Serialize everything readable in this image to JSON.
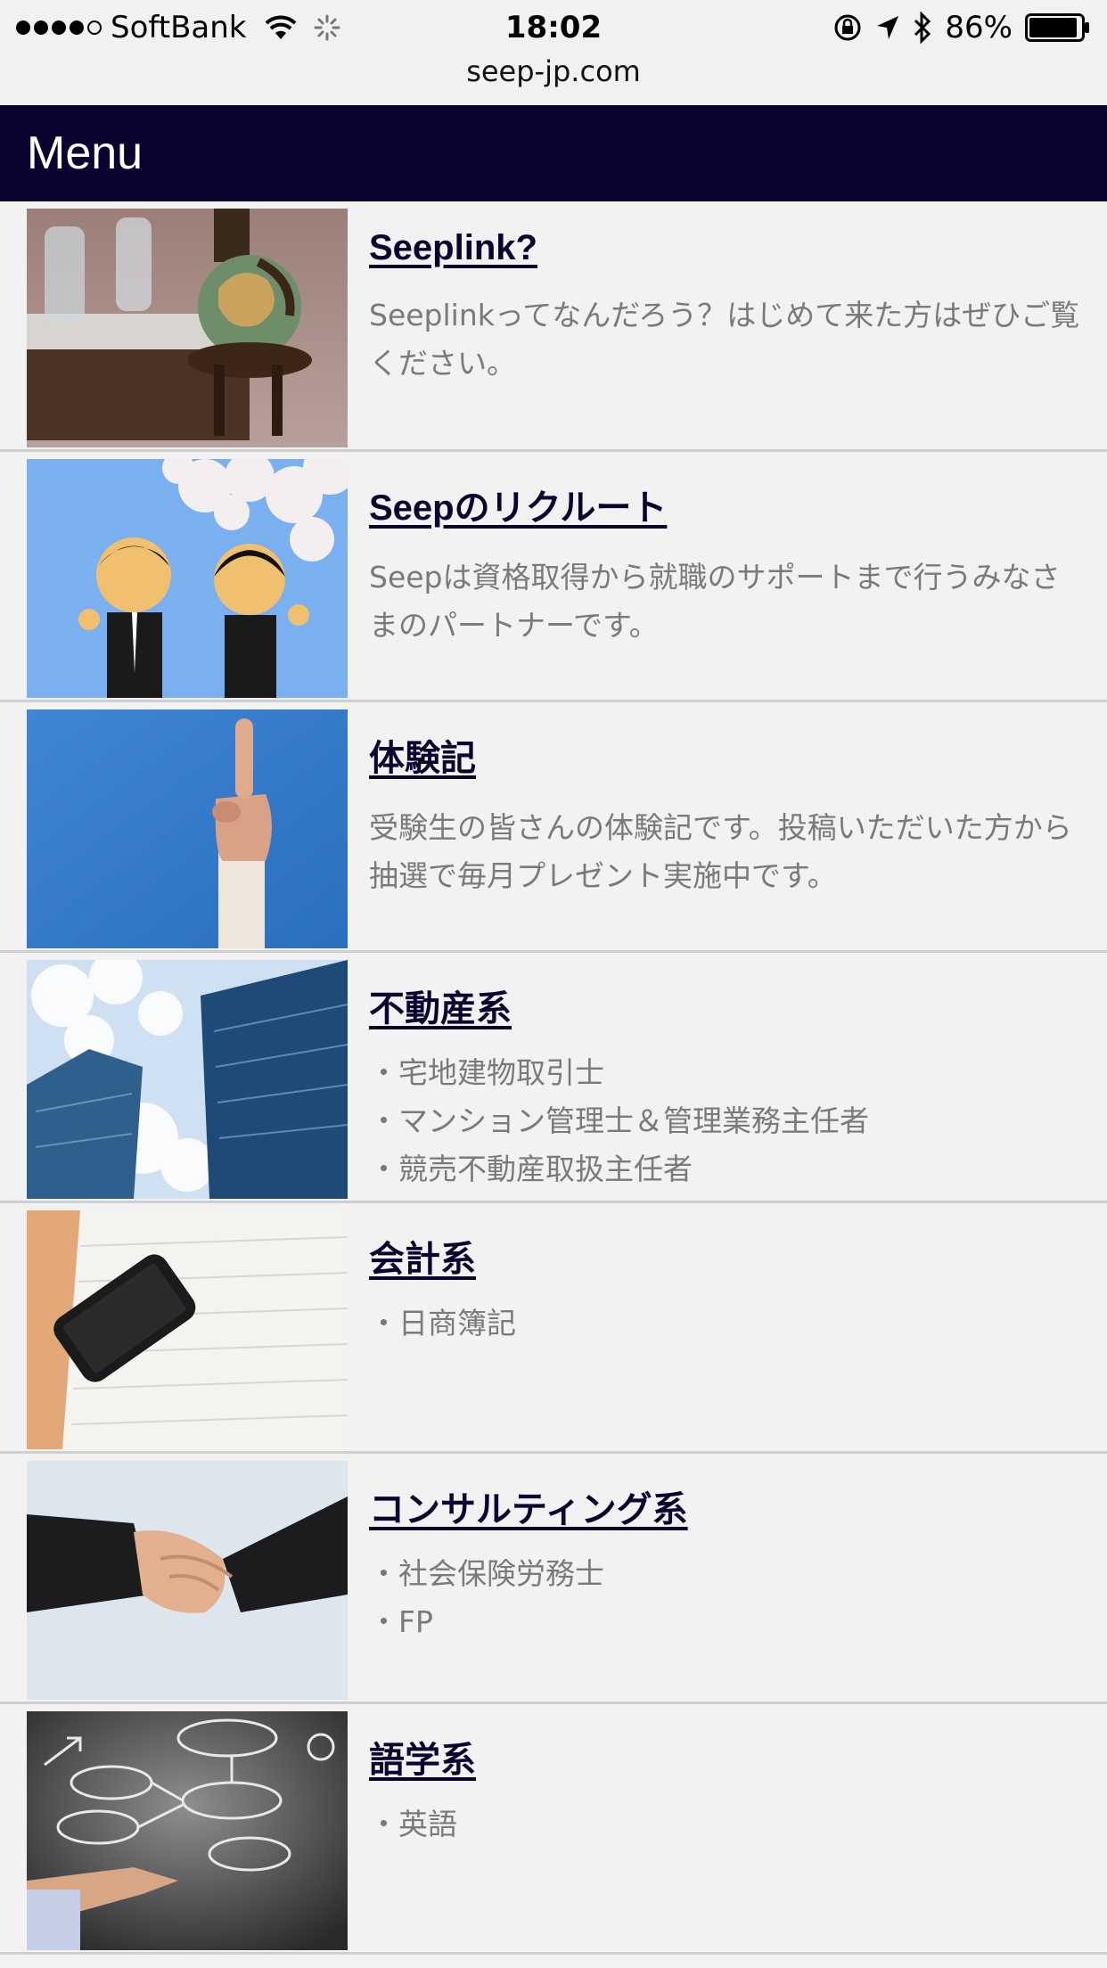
{
  "status_bar": {
    "carrier": "SoftBank",
    "time": "18:02",
    "battery": "86%",
    "signal_bars_filled": 4,
    "signal_bars_total": 5
  },
  "browser": {
    "url": "seep-jp.com"
  },
  "header": {
    "title": "Menu",
    "background_color": "#0b0230"
  },
  "menu": {
    "items": [
      {
        "title": "Seeplink?",
        "image_icon": "globe-and-book-photo",
        "description": "Seeplinkってなんだろう？はじめて来た方はぜひご覧ください。"
      },
      {
        "title": "Seepのリクルート",
        "image_icon": "recruits-under-cherry-blossoms-photo",
        "description": "Seepは資格取得から就職のサポートまで行うみなさまのパートナーです。"
      },
      {
        "title": "体験記",
        "image_icon": "raised-finger-sky-photo",
        "description": "受験生の皆さんの体験記です。投稿いただいた方から抽選で毎月プレゼント実施中です。"
      },
      {
        "title": "不動産系",
        "image_icon": "skyscrapers-photo",
        "bullets": [
          "宅地建物取引士",
          "マンション管理士＆管理業務主任者",
          "競売不動産取扱主任者"
        ]
      },
      {
        "title": "会計系",
        "image_icon": "phone-on-notebook-photo",
        "bullets": [
          "日商簿記"
        ]
      },
      {
        "title": "コンサルティング系",
        "image_icon": "handshake-photo",
        "bullets": [
          "社会保険労務士",
          "FP"
        ]
      },
      {
        "title": "語学系",
        "image_icon": "chalkboard-ideas-photo",
        "bullets": [
          "英語"
        ]
      }
    ]
  }
}
